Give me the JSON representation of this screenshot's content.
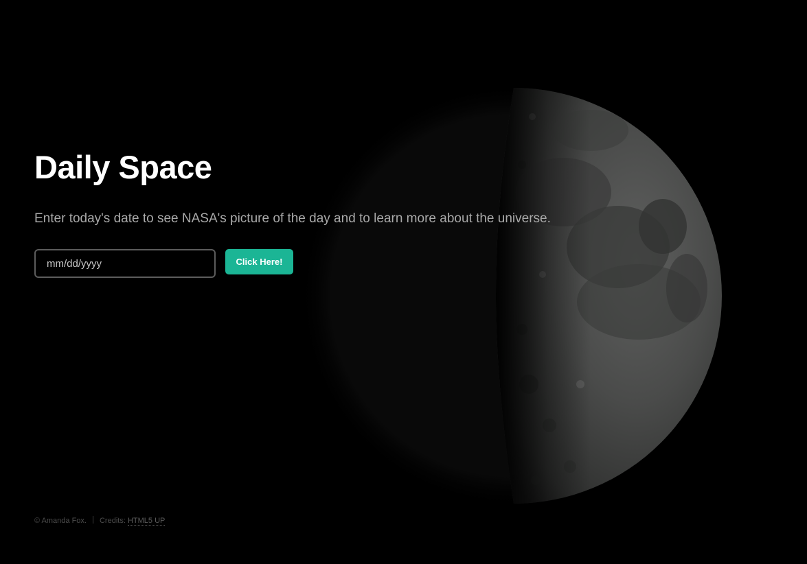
{
  "header": {
    "title": "Daily Space",
    "subtitle": "Enter today's date to see NASA's picture of the day and to learn more about the universe."
  },
  "form": {
    "date_placeholder": "mm/dd/yyyy",
    "submit_label": "Click Here!"
  },
  "footer": {
    "copyright": "© Amanda Fox.",
    "credits_label": "Credits:",
    "credits_link": "HTML5 UP"
  },
  "colors": {
    "background": "#000000",
    "accent": "#1bb595",
    "subtitle_text": "#a9a9a9"
  },
  "background_image": {
    "subject": "half-moon"
  }
}
